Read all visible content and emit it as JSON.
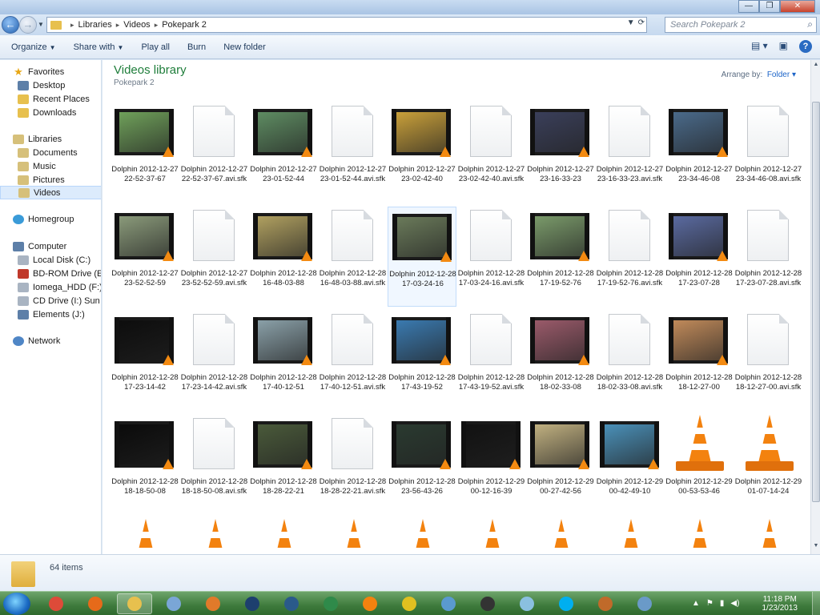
{
  "address": {
    "segments": [
      "Libraries",
      "Videos",
      "Pokepark 2"
    ],
    "search_placeholder": "Search Pokepark 2"
  },
  "toolbar": {
    "organize": "Organize",
    "share_with": "Share with",
    "play_all": "Play all",
    "burn": "Burn",
    "new_folder": "New folder"
  },
  "nav": {
    "favorites": "Favorites",
    "desktop": "Desktop",
    "recent_places": "Recent Places",
    "downloads": "Downloads",
    "libraries": "Libraries",
    "documents": "Documents",
    "music": "Music",
    "pictures": "Pictures",
    "videos": "Videos",
    "homegroup": "Homegroup",
    "computer": "Computer",
    "local_disk": "Local Disk (C:)",
    "bd_rom": "BD-ROM Drive (E:) B",
    "iomega": "Iomega_HDD (F:)",
    "cd_drive": "CD Drive (I:) Sun Bro",
    "elements": "Elements (J:)",
    "network": "Network"
  },
  "library": {
    "title": "Videos library",
    "subtitle": "Pokepark 2",
    "arrange_label": "Arrange by:",
    "arrange_value": "Folder"
  },
  "files": [
    {
      "name": "Dolphin 2012-12-27 22-52-37-67",
      "kind": "video",
      "tone": "#6fa05a"
    },
    {
      "name": "Dolphin 2012-12-27 22-52-37-67.avi.sfk",
      "kind": "doc"
    },
    {
      "name": "Dolphin 2012-12-27 23-01-52-44",
      "kind": "video",
      "tone": "#5e8c62"
    },
    {
      "name": "Dolphin 2012-12-27 23-01-52-44.avi.sfk",
      "kind": "doc"
    },
    {
      "name": "Dolphin 2012-12-27 23-02-42-40",
      "kind": "video",
      "tone": "#c9a03a"
    },
    {
      "name": "Dolphin 2012-12-27 23-02-42-40.avi.sfk",
      "kind": "doc"
    },
    {
      "name": "Dolphin 2012-12-27 23-16-33-23",
      "kind": "video",
      "tone": "#3a3f5a"
    },
    {
      "name": "Dolphin 2012-12-27 23-16-33-23.avi.sfk",
      "kind": "doc"
    },
    {
      "name": "Dolphin 2012-12-27 23-34-46-08",
      "kind": "video",
      "tone": "#4a6a8a"
    },
    {
      "name": "Dolphin 2012-12-27 23-34-46-08.avi.sfk",
      "kind": "doc"
    },
    {
      "name": "Dolphin 2012-12-27 23-52-52-59",
      "kind": "video",
      "tone": "#8a9a7a"
    },
    {
      "name": "Dolphin 2012-12-27 23-52-52-59.avi.sfk",
      "kind": "doc"
    },
    {
      "name": "Dolphin 2012-12-28 16-48-03-88",
      "kind": "video",
      "tone": "#b0a060"
    },
    {
      "name": "Dolphin 2012-12-28 16-48-03-88.avi.sfk",
      "kind": "doc"
    },
    {
      "name": "Dolphin 2012-12-28 17-03-24-16",
      "kind": "video",
      "tone": "#6a7a5a"
    },
    {
      "name": "Dolphin 2012-12-28 17-03-24-16.avi.sfk",
      "kind": "doc"
    },
    {
      "name": "Dolphin 2012-12-28 17-19-52-76",
      "kind": "video",
      "tone": "#7a9a6a"
    },
    {
      "name": "Dolphin 2012-12-28 17-19-52-76.avi.sfk",
      "kind": "doc"
    },
    {
      "name": "Dolphin 2012-12-28 17-23-07-28",
      "kind": "video",
      "tone": "#5a6aa0"
    },
    {
      "name": "Dolphin 2012-12-28 17-23-07-28.avi.sfk",
      "kind": "doc"
    },
    {
      "name": "Dolphin 2012-12-28 17-23-14-42",
      "kind": "video",
      "tone": "#0d0d0d"
    },
    {
      "name": "Dolphin 2012-12-28 17-23-14-42.avi.sfk",
      "kind": "doc"
    },
    {
      "name": "Dolphin 2012-12-28 17-40-12-51",
      "kind": "video",
      "tone": "#8aa0a8"
    },
    {
      "name": "Dolphin 2012-12-28 17-40-12-51.avi.sfk",
      "kind": "doc"
    },
    {
      "name": "Dolphin 2012-12-28 17-43-19-52",
      "kind": "video",
      "tone": "#3a7ab0"
    },
    {
      "name": "Dolphin 2012-12-28 17-43-19-52.avi.sfk",
      "kind": "doc"
    },
    {
      "name": "Dolphin 2012-12-28 18-02-33-08",
      "kind": "video",
      "tone": "#9a5a6a"
    },
    {
      "name": "Dolphin 2012-12-28 18-02-33-08.avi.sfk",
      "kind": "doc"
    },
    {
      "name": "Dolphin 2012-12-28 18-12-27-00",
      "kind": "video",
      "tone": "#c08a5a"
    },
    {
      "name": "Dolphin 2012-12-28 18-12-27-00.avi.sfk",
      "kind": "doc"
    },
    {
      "name": "Dolphin 2012-12-28 18-18-50-08",
      "kind": "video",
      "tone": "#0b0b0b"
    },
    {
      "name": "Dolphin 2012-12-28 18-18-50-08.avi.sfk",
      "kind": "doc"
    },
    {
      "name": "Dolphin 2012-12-28 18-28-22-21",
      "kind": "video",
      "tone": "#4a5a3a"
    },
    {
      "name": "Dolphin 2012-12-28 18-28-22-21.avi.sfk",
      "kind": "doc"
    },
    {
      "name": "Dolphin 2012-12-28 23-56-43-26",
      "kind": "video",
      "tone": "#2a3a30"
    },
    {
      "name": "Dolphin 2012-12-29 00-12-16-39",
      "kind": "video",
      "tone": "#121212"
    },
    {
      "name": "Dolphin 2012-12-29 00-27-42-56",
      "kind": "video",
      "tone": "#c0b080"
    },
    {
      "name": "Dolphin 2012-12-29 00-42-49-10",
      "kind": "video",
      "tone": "#4a90b8"
    },
    {
      "name": "Dolphin 2012-12-29 00-53-53-46",
      "kind": "vlc"
    },
    {
      "name": "Dolphin 2012-12-29 01-07-14-24",
      "kind": "vlc"
    },
    {
      "name": "",
      "kind": "vlc"
    },
    {
      "name": "",
      "kind": "vlc"
    },
    {
      "name": "",
      "kind": "vlc"
    },
    {
      "name": "",
      "kind": "vlc"
    },
    {
      "name": "",
      "kind": "vlc"
    },
    {
      "name": "",
      "kind": "vlc"
    },
    {
      "name": "",
      "kind": "vlc"
    },
    {
      "name": "",
      "kind": "vlc"
    },
    {
      "name": "",
      "kind": "vlc"
    },
    {
      "name": "",
      "kind": "vlc"
    }
  ],
  "selected_index": 14,
  "details": {
    "count": "64 items"
  },
  "taskbar": {
    "time": "11:18 PM",
    "date": "1/23/2013",
    "apps": [
      {
        "name": "chrome-icon",
        "color": "#dd4b39"
      },
      {
        "name": "firefox-icon",
        "color": "#e66a1a"
      },
      {
        "name": "explorer-icon",
        "color": "#e7c04e",
        "active": true
      },
      {
        "name": "notepad-icon",
        "color": "#7aa6d6"
      },
      {
        "name": "media-player-icon",
        "color": "#e07a2a"
      },
      {
        "name": "photoshop-icon",
        "color": "#1d3f6e"
      },
      {
        "name": "disc-icon",
        "color": "#2a5a8a"
      },
      {
        "name": "globe-icon",
        "color": "#2f8a4a"
      },
      {
        "name": "vlc-icon",
        "color": "#f3820f"
      },
      {
        "name": "v-app-icon",
        "color": "#e0c020"
      },
      {
        "name": "network-app-icon",
        "color": "#5a9ad0"
      },
      {
        "name": "game-app-icon",
        "color": "#333333"
      },
      {
        "name": "penguin-icon",
        "color": "#8ac0e0"
      },
      {
        "name": "skype-icon",
        "color": "#00aff0"
      },
      {
        "name": "pokemon-icon",
        "color": "#c06a2a"
      },
      {
        "name": "picture-viewer-icon",
        "color": "#6a9ac8"
      }
    ]
  }
}
